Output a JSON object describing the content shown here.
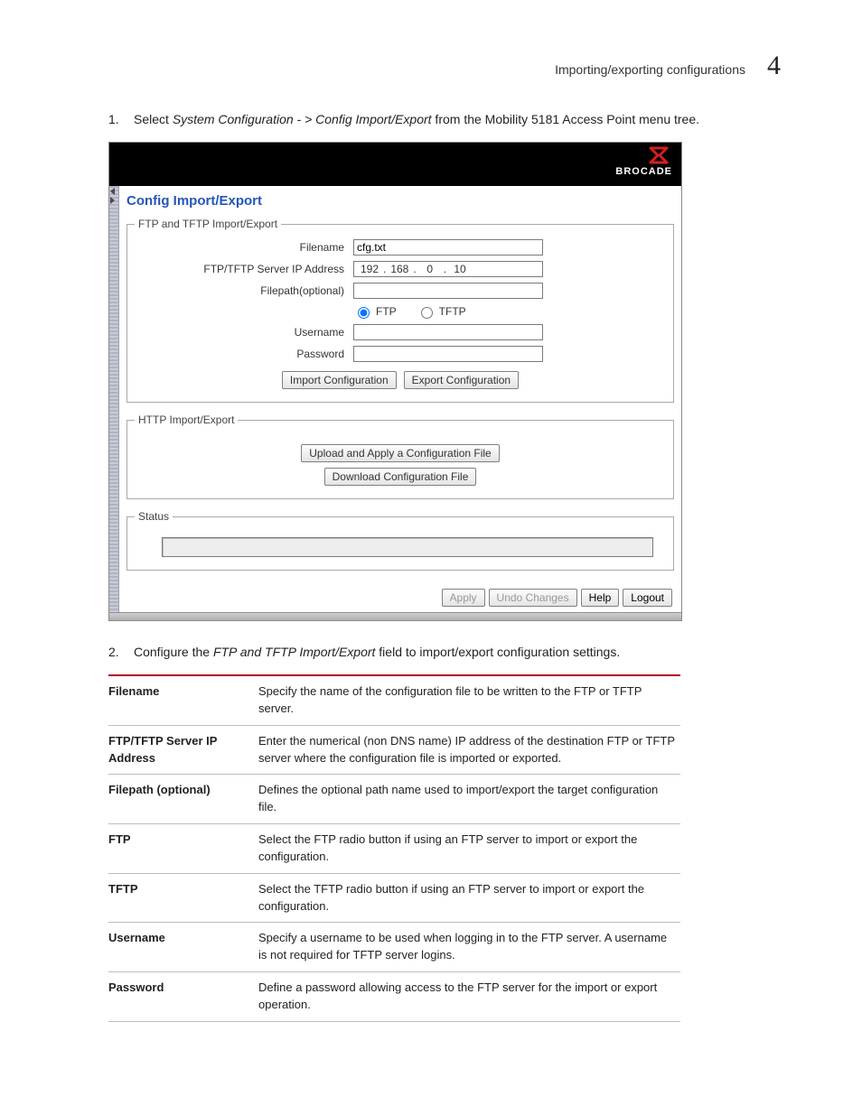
{
  "header": {
    "section_title": "Importing/exporting configurations",
    "section_number": "4"
  },
  "steps": {
    "s1_num": "1.",
    "s1_pre": "Select ",
    "s1_em": "System Configuration - > Config Import/Export",
    "s1_post": " from the Mobility 5181 Access Point menu tree.",
    "s2_num": "2.",
    "s2_pre": "Configure the ",
    "s2_em": "FTP and TFTP Import/Export",
    "s2_post": " field to import/export configuration settings."
  },
  "shot": {
    "brand": "BROCADE",
    "panel_title": "Config Import/Export",
    "fs1_legend": "FTP and TFTP Import/Export",
    "labels": {
      "filename": "Filename",
      "ip": "FTP/TFTP Server IP Address",
      "filepath": "Filepath(optional)",
      "username": "Username",
      "password": "Password"
    },
    "values": {
      "filename": "cfg.txt",
      "ip": [
        "192",
        "168",
        "0",
        "10"
      ],
      "filepath": "",
      "username": "",
      "password": ""
    },
    "radios": {
      "ftp": "FTP",
      "tftp": "TFTP",
      "selected": "ftp"
    },
    "buttons": {
      "import": "Import Configuration",
      "export": "Export Configuration",
      "upload": "Upload and Apply a Configuration File",
      "download": "Download Configuration File"
    },
    "fs2_legend": "HTTP Import/Export",
    "fs3_legend": "Status",
    "footer": {
      "apply": "Apply",
      "undo": "Undo Changes",
      "help": "Help",
      "logout": "Logout"
    }
  },
  "table": [
    {
      "k": "Filename",
      "v": "Specify the name of the configuration file to be written to the FTP or TFTP server."
    },
    {
      "k": "FTP/TFTP Server IP Address",
      "v": "Enter the numerical (non DNS name) IP address of the destination FTP or TFTP server where the configuration file is imported or exported."
    },
    {
      "k": "Filepath (optional)",
      "v": "Defines the optional path name used to import/export the target configuration file."
    },
    {
      "k": "FTP",
      "v": "Select the FTP radio button if using an FTP server to import or export the configuration."
    },
    {
      "k": "TFTP",
      "v": "Select the TFTP radio button if using an FTP server to import or export the configuration."
    },
    {
      "k": "Username",
      "v": "Specify a username to be used when logging in to the FTP server. A username is not required for TFTP server logins."
    },
    {
      "k": "Password",
      "v": "Define a password allowing access to the FTP server for the import or export operation."
    }
  ]
}
